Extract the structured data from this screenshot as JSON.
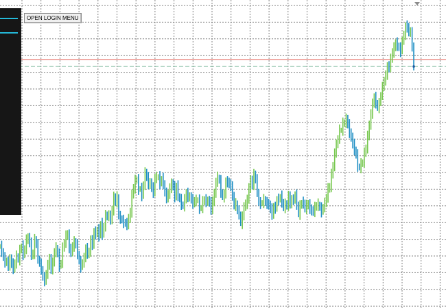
{
  "toolbar": {
    "login_label": "OPEN LOGIN MENU"
  },
  "colors": {
    "background": "#ffffff",
    "grid": "#7f7f7f",
    "bull_bar": "#78c850",
    "bear_bar": "#1f8fc4",
    "resistance_line": "#e05a4f",
    "current_price_line": "#7ab89a",
    "panel_bg": "#161616",
    "panel_accent": "#24b9d8"
  },
  "chart_data": {
    "type": "ohlc",
    "title": "",
    "xlabel": "",
    "ylabel": "",
    "grid": true,
    "ylim": [
      0,
      100
    ],
    "price_levels": {
      "resistance": 82.1,
      "current": 79.8
    },
    "series": [
      {
        "values": [
          20.1,
          18.5,
          16.4,
          14.9,
          15.1,
          13.6,
          16.0,
          14.4,
          12.7,
          14.6,
          16.9,
          15.7,
          18.7,
          20.2,
          17.4,
          19.3,
          22.3,
          23.0,
          21.4,
          17.2,
          17.7,
          22.4,
          20.7,
          16.2,
          14.2,
          12.6,
          9.8,
          8.7,
          11.0,
          13.9,
          16.1,
          12.5,
          14.7,
          18.3,
          19.6,
          17.5,
          13.6,
          14.8,
          19.5,
          21.4,
          23.6,
          24.1,
          19.4,
          18.2,
          20.1,
          21.7,
          20.6,
          17.7,
          15.0,
          13.3,
          14.9,
          16.1,
          19.5,
          17.7,
          18.2,
          22.2,
          20.6,
          24.9,
          24.2,
          25.6,
          23.6,
          27.7,
          24.1,
          26.8,
          30.3,
          30.1,
          30.4,
          28.9,
          32.1,
          36.5,
          34.8,
          36.5,
          30.0,
          29.5,
          28.7,
          28.0,
          27.8,
          27.2,
          29.4,
          31.3,
          37.3,
          39.4,
          42.0,
          42.2,
          39.0,
          39.3,
          36.9,
          40.6,
          44.5,
          43.1,
          40.7,
          41.2,
          39.6,
          37.9,
          42.9,
          43.0,
          43.1,
          40.9,
          42.6,
          40.9,
          37.8,
          36.1,
          37.4,
          39.4,
          41.0,
          40.0,
          36.5,
          40.1,
          36.9,
          35.6,
          34.0,
          33.5,
          35.6,
          37.8,
          36.5,
          36.5,
          35.8,
          34.3,
          35.2,
          35.4,
          35.4,
          32.7,
          33.0,
          34.9,
          35.6,
          34.9,
          35.2,
          34.9,
          32.2,
          35.2,
          37.4,
          41.7,
          43.0,
          41.8,
          38.1,
          36.5,
          37.2,
          41.7,
          41.4,
          40.8,
          40.0,
          36.9,
          33.7,
          34.3,
          31.8,
          30.9,
          27.7,
          29.8,
          33.7,
          33.8,
          35.9,
          39.4,
          42.1,
          40.5,
          44.0,
          42.2,
          38.3,
          34.5,
          34.4,
          34.6,
          35.6,
          34.7,
          34.3,
          33.7,
          32.7,
          30.6,
          33.1,
          32.7,
          35.7,
          35.5,
          36.7,
          34.8,
          32.9,
          34.1,
          33.6,
          36.8,
          34.2,
          35.6,
          35.5,
          37.1,
          34.0,
          30.8,
          33.5,
          34.7,
          34.5,
          32.5,
          33.8,
          34.1,
          32.4,
          32.0,
          31.6,
          33.1,
          33.7,
          34.1,
          32.8,
          31.6,
          33.2,
          34.4,
          36.3,
          39.4,
          39.6,
          44.3,
          46.3,
          51.3,
          53.7,
          56.0,
          58.6,
          58.6,
          60.9,
          61.1,
          62.3,
          60.6,
          57.6,
          56.4,
          54.0,
          52.0,
          50.4,
          46.7,
          46.2,
          47.4,
          48.0,
          51.0,
          52.6,
          56.7,
          60.3,
          64.0,
          67.4,
          69.5,
          67.6,
          66.1,
          67.4,
          70.5,
          72.7,
          75.2,
          76.6,
          79.8,
          79.4,
          82.4,
          84.3,
          86.0,
          87.5,
          86.7,
          85.8,
          84.7,
          88.7,
          89.7,
          93.2,
          92.7,
          91.1,
          91.1,
          86.3,
          79.8
        ]
      }
    ]
  }
}
